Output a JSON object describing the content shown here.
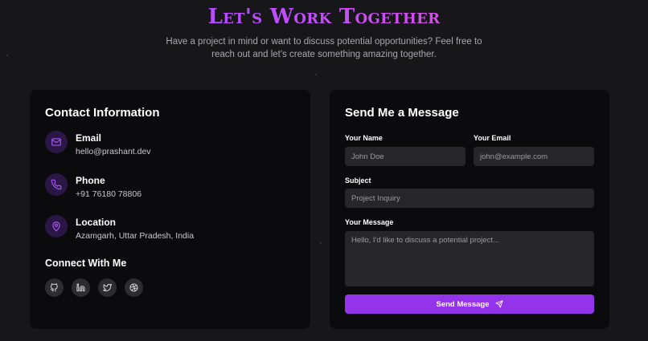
{
  "header": {
    "title": "Let's Work Together",
    "subtitle": "Have a project in mind or want to discuss potential opportunities? Feel free to reach out and let's create something amazing together."
  },
  "contact": {
    "title": "Contact Information",
    "items": [
      {
        "icon": "mail-icon",
        "label": "Email",
        "value": "hello@prashant.dev"
      },
      {
        "icon": "phone-icon",
        "label": "Phone",
        "value": "+91 76180 78806"
      },
      {
        "icon": "map-pin-icon",
        "label": "Location",
        "value": "Azamgarh, Uttar Pradesh, India"
      }
    ],
    "connect_title": "Connect With Me",
    "socials": [
      "github-icon",
      "linkedin-icon",
      "twitter-icon",
      "dribbble-icon"
    ]
  },
  "form": {
    "title": "Send Me a Message",
    "name_label": "Your Name",
    "name_placeholder": "John Doe",
    "email_label": "Your Email",
    "email_placeholder": "john@example.com",
    "subject_label": "Subject",
    "subject_placeholder": "Project Inquiry",
    "message_label": "Your Message",
    "message_placeholder": "Hello, I'd like to discuss a potential project...",
    "submit_label": "Send Message",
    "submit_icon": "send-icon"
  },
  "colors": {
    "background": "#17171a",
    "card": "#0b0b0e",
    "accent": "#9333ea",
    "icon_circle": "#2b1746",
    "heading_gradient": [
      "#9d4dff",
      "#f050c8"
    ]
  }
}
